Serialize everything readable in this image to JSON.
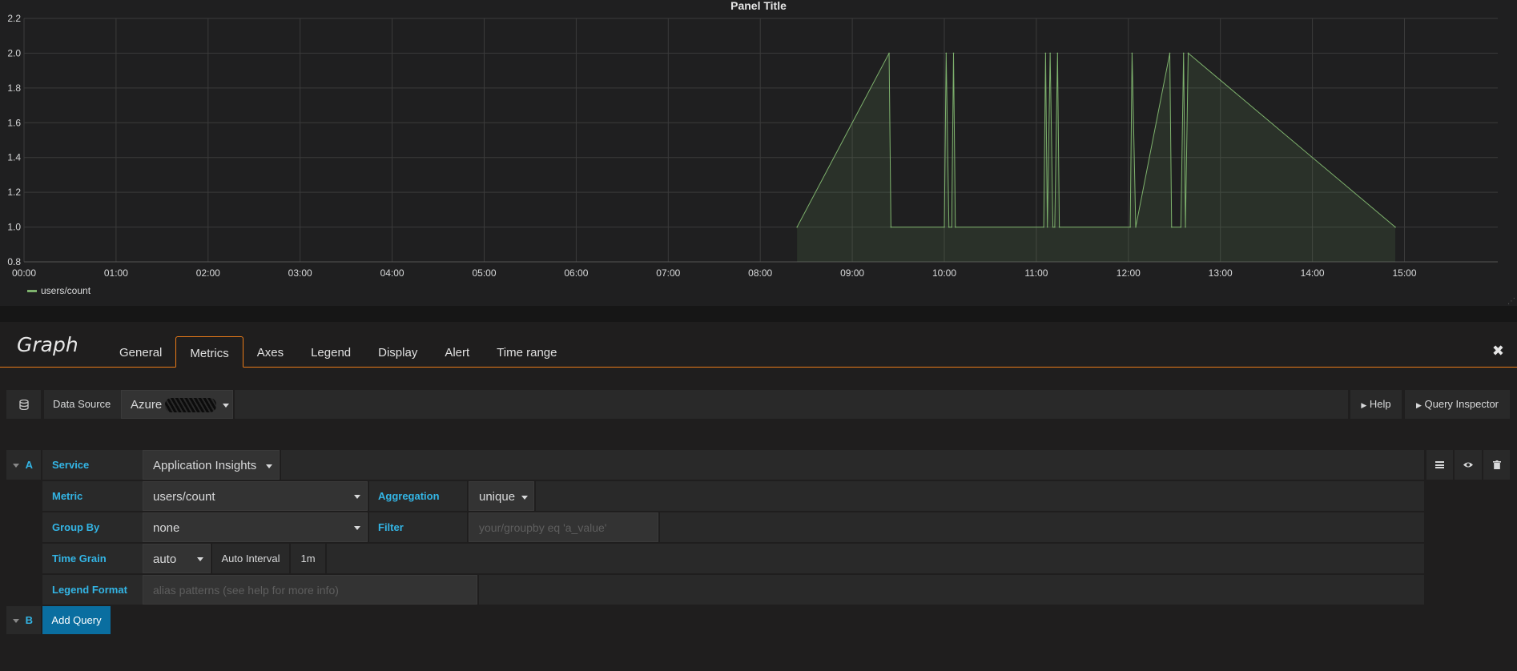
{
  "panel": {
    "title": "Panel Title"
  },
  "chart_data": {
    "type": "area",
    "title": "Panel Title",
    "xlabel": "",
    "ylabel": "",
    "x_ticks": [
      "00:00",
      "01:00",
      "02:00",
      "03:00",
      "04:00",
      "05:00",
      "06:00",
      "07:00",
      "08:00",
      "09:00",
      "10:00",
      "11:00",
      "12:00",
      "13:00",
      "14:00",
      "15:00"
    ],
    "y_ticks": [
      "0.8",
      "1.0",
      "1.2",
      "1.4",
      "1.6",
      "1.8",
      "2.0",
      "2.2"
    ],
    "ylim": [
      0.8,
      2.2
    ],
    "xlim_hours": [
      0,
      15.9
    ],
    "grid": true,
    "series": [
      {
        "name": "users/count",
        "color": "#7eb26d",
        "x_hours": [
          8.4,
          9.4,
          9.42,
          10.0,
          10.02,
          10.05,
          10.08,
          10.1,
          10.12,
          11.08,
          11.1,
          11.12,
          11.15,
          11.18,
          11.2,
          11.23,
          11.25,
          12.02,
          12.04,
          12.08,
          12.45,
          12.47,
          12.57,
          12.6,
          12.62,
          12.65,
          14.9
        ],
        "values": [
          1.0,
          2.0,
          1.0,
          1.0,
          2.0,
          1.0,
          1.0,
          2.0,
          1.0,
          1.0,
          2.0,
          1.0,
          2.0,
          1.0,
          1.0,
          2.0,
          1.0,
          1.0,
          2.0,
          1.0,
          2.0,
          1.0,
          1.0,
          2.0,
          1.0,
          2.0,
          1.0
        ]
      }
    ],
    "legend": "bottom-left"
  },
  "editor": {
    "title": "Graph",
    "tabs": [
      "General",
      "Metrics",
      "Axes",
      "Legend",
      "Display",
      "Alert",
      "Time range"
    ],
    "active_tab": "Metrics",
    "close": "✖"
  },
  "datasource": {
    "label": "Data Source",
    "value": "Azure",
    "help": "Help",
    "inspector": "Query Inspector"
  },
  "query_a": {
    "ref": "A",
    "service_label": "Service",
    "service_value": "Application Insights",
    "metric_label": "Metric",
    "metric_value": "users/count",
    "aggregation_label": "Aggregation",
    "aggregation_value": "unique",
    "groupby_label": "Group By",
    "groupby_value": "none",
    "filter_label": "Filter",
    "filter_placeholder": "your/groupby eq 'a_value'",
    "timegrain_label": "Time Grain",
    "timegrain_value": "auto",
    "auto_interval_label": "Auto Interval",
    "auto_interval_value": "1m",
    "legend_label": "Legend Format",
    "legend_placeholder": "alias patterns (see help for more info)"
  },
  "query_b": {
    "ref": "B",
    "add_label": "Add Query"
  }
}
